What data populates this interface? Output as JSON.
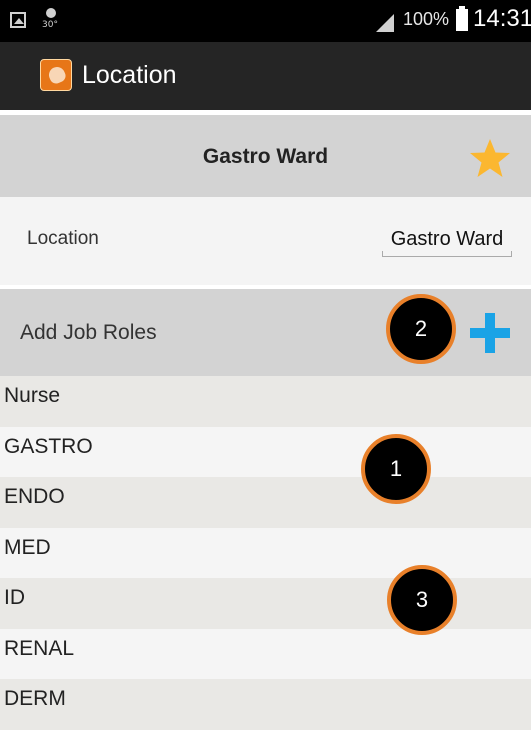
{
  "status_bar": {
    "weather_temp": "30°",
    "battery": "100%",
    "time": "14:31",
    "icons": [
      "gallery-icon",
      "weather-icon",
      "signal-icon",
      "battery-icon"
    ]
  },
  "action_bar": {
    "title": "Location",
    "icon": "app-hand-icon",
    "icon_color": "#e77618"
  },
  "header": {
    "title": "Gastro Ward",
    "favorite_icon": "star-icon",
    "star_color": "#fbb730"
  },
  "location": {
    "label": "Location",
    "value": "Gastro Ward"
  },
  "job_roles": {
    "title": "Add Job Roles",
    "add_icon": "plus-icon",
    "add_color": "#1aa3e6",
    "items": [
      "Nurse",
      "GASTRO",
      "ENDO",
      "MED",
      "ID",
      "RENAL",
      "DERM"
    ]
  },
  "markers": {
    "one": "1",
    "two": "2",
    "three": "3",
    "ring_color": "#e8802a"
  }
}
